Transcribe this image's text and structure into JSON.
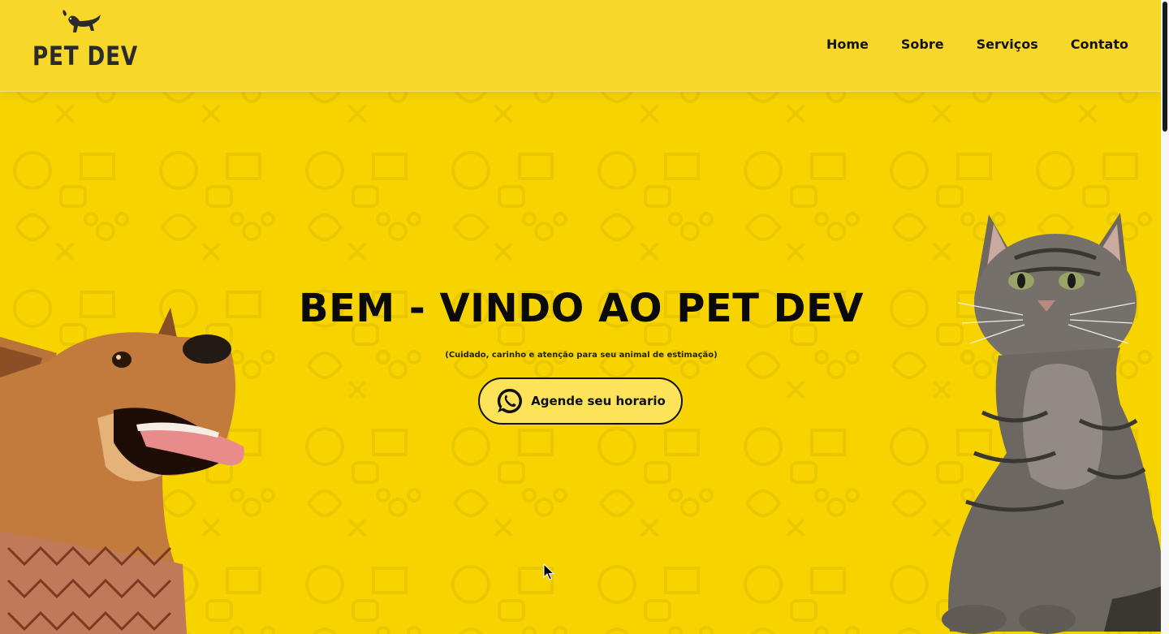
{
  "brand": {
    "name": "PET DEV",
    "logo_icon": "dachshund-icon"
  },
  "nav": {
    "items": [
      {
        "label": "Home"
      },
      {
        "label": "Sobre"
      },
      {
        "label": "Serviços"
      },
      {
        "label": "Contato"
      }
    ]
  },
  "hero": {
    "title": "BEM - VINDO AO PET DEV",
    "subtitle": "(Cuidado, carinho e atenção para seu animal de estimação)",
    "cta_label": "Agende seu horario",
    "cta_icon": "whatsapp-icon"
  },
  "images": {
    "dog": "dog-photo",
    "cat": "cat-photo"
  },
  "colors": {
    "background": "#f7d400",
    "header": "#f8d72b",
    "cta_background": "#fde35a",
    "text": "#111111"
  }
}
